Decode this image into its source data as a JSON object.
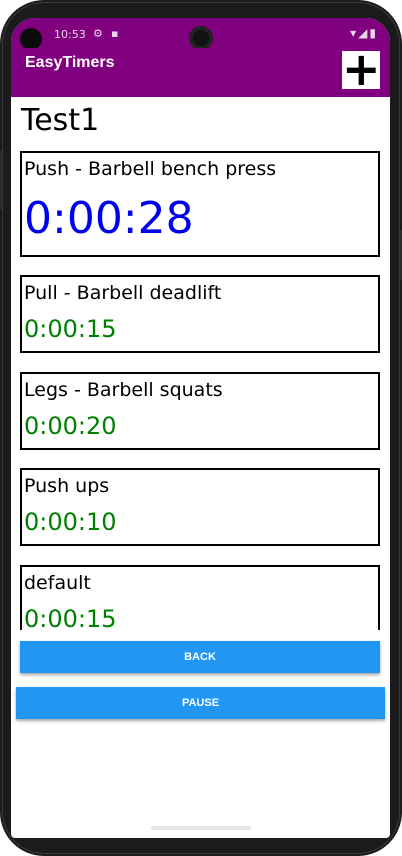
{
  "status_bar": {
    "time": "10:53",
    "icons_left": [
      "settings-icon",
      "sim-card-icon"
    ],
    "icons_right": [
      "wifi-icon",
      "signal-icon",
      "battery-icon"
    ]
  },
  "app": {
    "title": "EasyTimers",
    "add_label": "+",
    "accent": "#800080"
  },
  "workout": {
    "title": "Test1",
    "timers": [
      {
        "name": "Push - Barbell bench press",
        "time": "0:00:28",
        "active": true
      },
      {
        "name": "Pull - Barbell deadlift",
        "time": "0:00:15",
        "active": false
      },
      {
        "name": "Legs - Barbell squats",
        "time": "0:00:20",
        "active": false
      },
      {
        "name": "Push ups",
        "time": "0:00:10",
        "active": false
      },
      {
        "name": "default",
        "time": "0:00:15",
        "active": false
      }
    ]
  },
  "buttons": {
    "back": "BACK",
    "pause": "PAUSE",
    "color": "#2196f3"
  },
  "colors": {
    "active_timer": "#0000ee",
    "idle_timer": "#008000"
  }
}
